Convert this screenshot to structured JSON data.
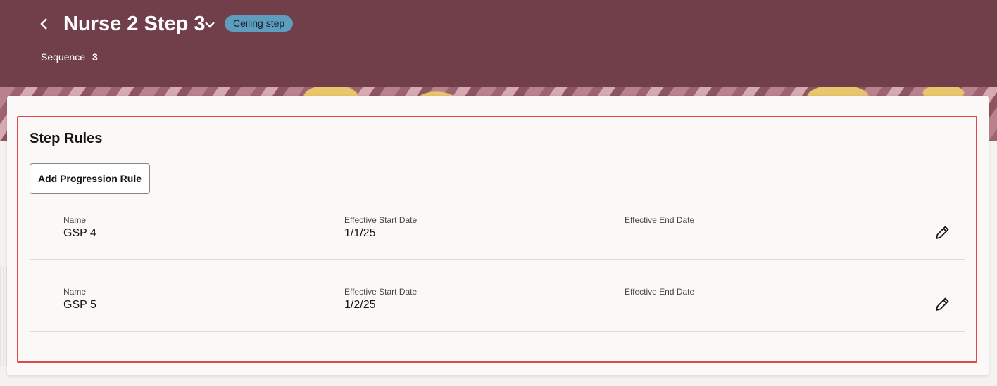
{
  "header": {
    "title": "Nurse 2 Step 3",
    "badge": "Ceiling step",
    "sequence_label": "Sequence",
    "sequence_value": "3"
  },
  "section": {
    "title": "Step Rules",
    "add_button": "Add Progression Rule"
  },
  "columns": {
    "name": "Name",
    "start": "Effective Start Date",
    "end": "Effective End Date"
  },
  "rules": [
    {
      "name": "GSP 4",
      "start": "1/1/25",
      "end": ""
    },
    {
      "name": "GSP 5",
      "start": "1/2/25",
      "end": ""
    }
  ],
  "colors": {
    "header_bg": "#703f4a",
    "badge_bg": "#5f9dbf",
    "highlight": "#e04949"
  },
  "icons": [
    "back-chevron-icon",
    "chevron-down-icon",
    "pencil-icon"
  ]
}
